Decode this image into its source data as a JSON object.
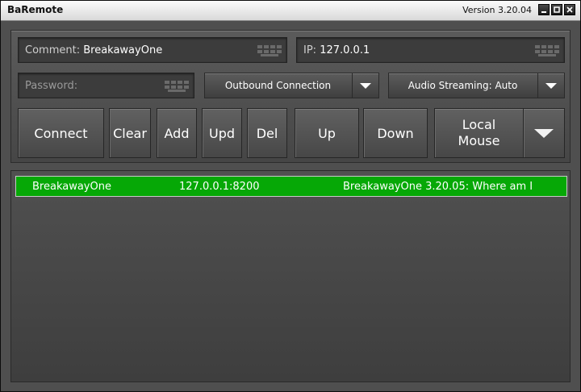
{
  "window": {
    "title": "BaRemote",
    "version": "Version 3.20.04"
  },
  "fields": {
    "comment_label": "Comment:",
    "comment_value": "BreakawayOne",
    "ip_label": "IP:",
    "ip_value": "127.0.0.1",
    "password_placeholder": "Password:"
  },
  "dropdowns": {
    "connection": "Outbound Connection",
    "audio": "Audio Streaming: Auto"
  },
  "buttons": {
    "connect": "Connect",
    "clear": "Clear",
    "add": "Add",
    "upd": "Upd",
    "del": "Del",
    "up": "Up",
    "down": "Down",
    "local_line1": "Local",
    "local_line2": "Mouse"
  },
  "list": [
    {
      "name": "BreakawayOne",
      "address": "127.0.0.1:8200",
      "status": "BreakawayOne 3.20.05: Where am I"
    }
  ],
  "colors": {
    "selected_row": "#06a806"
  },
  "icons": {
    "keyboard": "keyboard-icon",
    "dropdown": "chevron-down-icon"
  }
}
